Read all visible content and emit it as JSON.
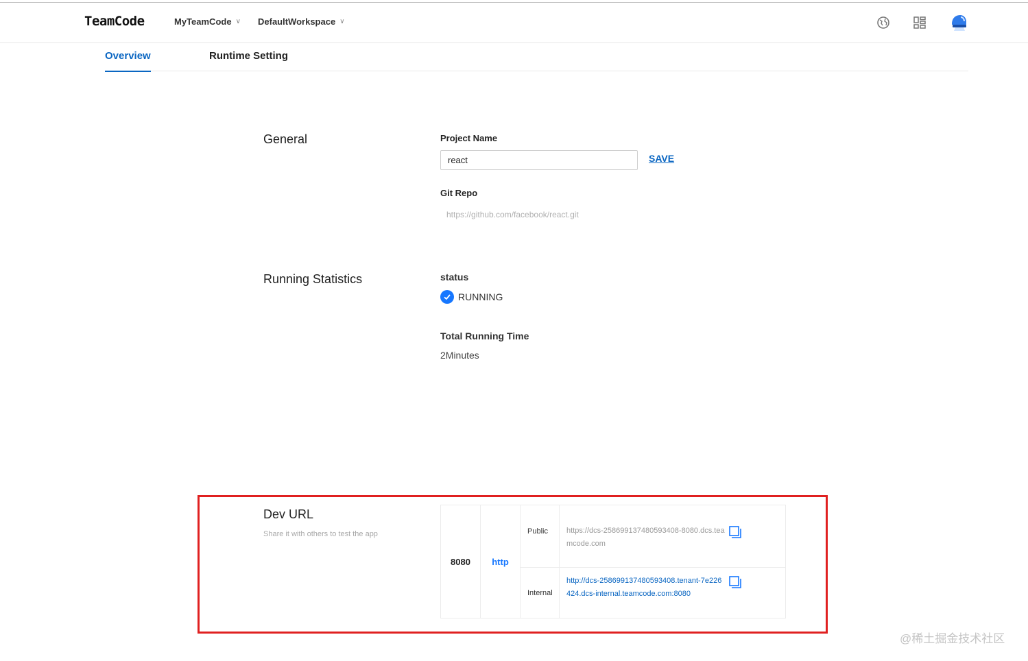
{
  "header": {
    "logo": "TeamCode",
    "team": "MyTeamCode",
    "workspace": "DefaultWorkspace"
  },
  "tabs": [
    {
      "label": "Overview",
      "active": true
    },
    {
      "label": "Runtime Setting",
      "active": false
    }
  ],
  "general": {
    "title": "General",
    "project_name_label": "Project Name",
    "project_name_value": "react",
    "save_label": "SAVE",
    "git_repo_label": "Git Repo",
    "git_repo_value": "https://github.com/facebook/react.git"
  },
  "stats": {
    "title": "Running Statistics",
    "status_label": "status",
    "status_value": "RUNNING",
    "total_time_label": "Total Running Time",
    "total_time_value": "2Minutes"
  },
  "dev_url": {
    "title": "Dev URL",
    "subtitle": "Share it with others to test the app",
    "port": "8080",
    "protocol": "http",
    "public_label": "Public",
    "public_url": "https://dcs-258699137480593408-8080.dcs.teamcode.com",
    "internal_label": "Internal",
    "internal_url": "http://dcs-258699137480593408.tenant-7e226424.dcs-internal.teamcode.com:8080"
  },
  "watermark": "@稀土掘金技术社区",
  "colors": {
    "accent": "#0a66c2",
    "status_check": "#1677ff",
    "highlight_border": "#e02020"
  },
  "icons": [
    "globe-icon",
    "apps-grid-icon",
    "avatar-icon",
    "chevron-down-icon",
    "check-circle-icon",
    "copy-icon"
  ]
}
